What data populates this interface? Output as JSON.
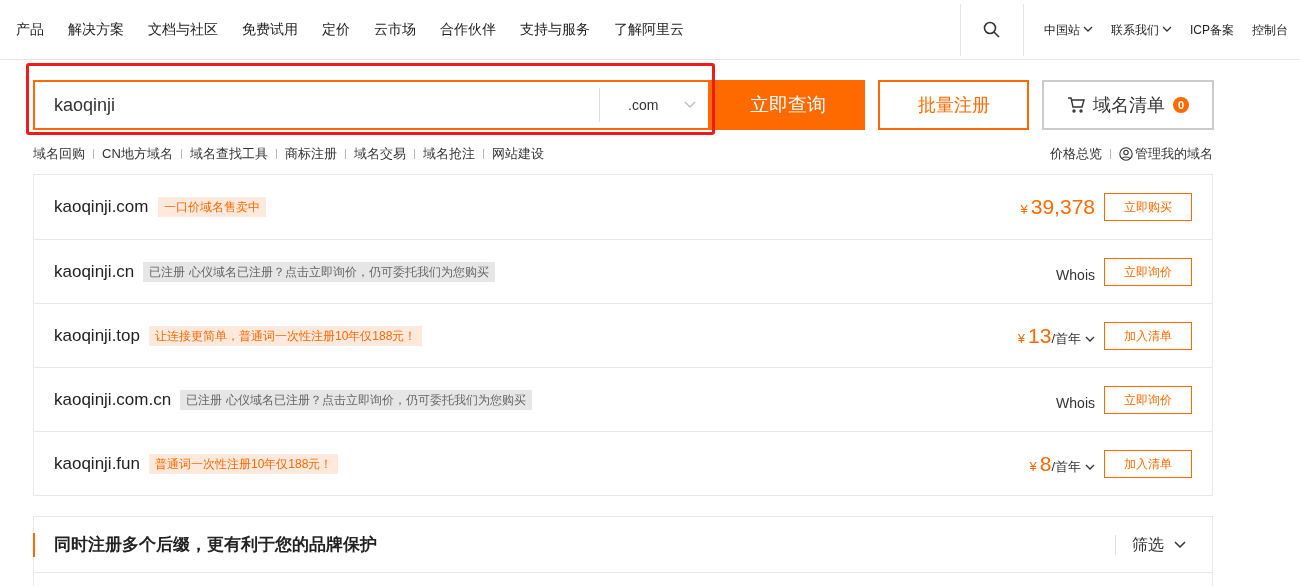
{
  "nav": {
    "items": [
      "产品",
      "解决方案",
      "文档与社区",
      "免费试用",
      "定价",
      "云市场",
      "合作伙伴",
      "支持与服务",
      "了解阿里云"
    ],
    "right": [
      {
        "label": "中国站",
        "dropdown": true
      },
      {
        "label": "联系我们",
        "dropdown": true
      },
      {
        "label": "ICP备案",
        "dropdown": false
      },
      {
        "label": "控制台",
        "dropdown": false
      }
    ]
  },
  "search": {
    "value": "kaoqinji",
    "suffix": ".com",
    "submit": "立即查询",
    "bulk": "批量注册",
    "cart": {
      "label": "域名清单",
      "count": "0"
    }
  },
  "links": [
    "域名回购",
    "CN地方域名",
    "域名查找工具",
    "商标注册",
    "域名交易",
    "域名抢注",
    "网站建设"
  ],
  "right_links": {
    "price": "价格总览",
    "manage": "管理我的域名"
  },
  "results": [
    {
      "kind": "sale",
      "domain": "kaoqinji.com",
      "tag": "一口价域名售卖中",
      "currency": "¥",
      "price": "39,378",
      "action": "立即购买"
    },
    {
      "kind": "taken",
      "domain": "kaoqinji.cn",
      "tag": "已注册 心仪域名已注册？点击立即询价，仍可委托我们为您购买",
      "whois": "Whois",
      "action": "立即询价"
    },
    {
      "kind": "available",
      "domain": "kaoqinji.top",
      "tag": "让连接更简单，普通词一次性注册10年仅188元！",
      "currency": "¥",
      "price": "13",
      "unit": "/首年",
      "action": "加入清单"
    },
    {
      "kind": "taken",
      "domain": "kaoqinji.com.cn",
      "tag": "已注册 心仪域名已注册？点击立即询价，仍可委托我们为您购买",
      "whois": "Whois",
      "action": "立即询价"
    },
    {
      "kind": "available",
      "domain": "kaoqinji.fun",
      "tag": "普通词一次性注册10年仅188元！",
      "currency": "¥",
      "price": "8",
      "unit": "/首年",
      "action": "加入清单"
    }
  ],
  "section": {
    "title": "同时注册多个后缀，更有利于您的品牌保护",
    "filter": "筛选"
  }
}
